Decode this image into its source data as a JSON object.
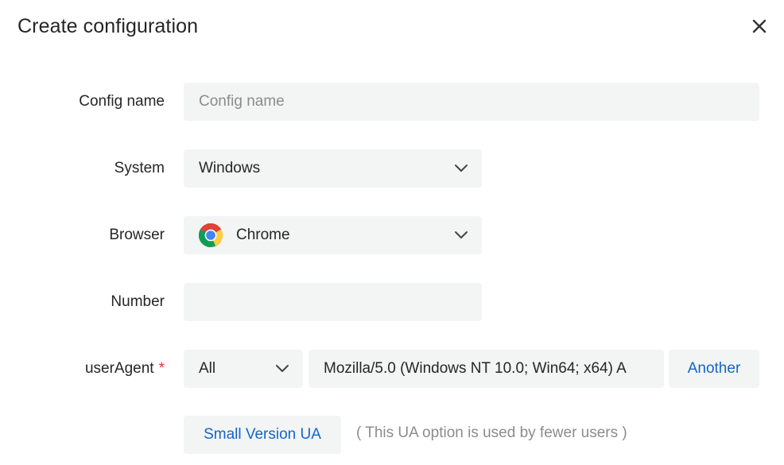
{
  "dialog": {
    "title": "Create configuration",
    "close_icon": "close-icon"
  },
  "form": {
    "config_name": {
      "label": "Config name",
      "placeholder": "Config name",
      "value": ""
    },
    "system": {
      "label": "System",
      "value": "Windows",
      "icon": "chevron-down-icon"
    },
    "browser": {
      "label": "Browser",
      "value": "Chrome",
      "icon": "chrome-icon"
    },
    "number": {
      "label": "Number",
      "value": ""
    },
    "user_agent": {
      "label": "userAgent",
      "required_mark": "*",
      "filter_value": "All",
      "value": "Mozilla/5.0 (Windows NT 10.0; Win64; x64) A",
      "another_button": "Another"
    },
    "small_version": {
      "button": "Small Version UA",
      "hint": "( This UA option is used by fewer users )"
    }
  },
  "colors": {
    "accent": "#1266c9",
    "required": "#e0312f",
    "field_bg": "#f3f4f4",
    "placeholder": "#8c8c8c"
  }
}
